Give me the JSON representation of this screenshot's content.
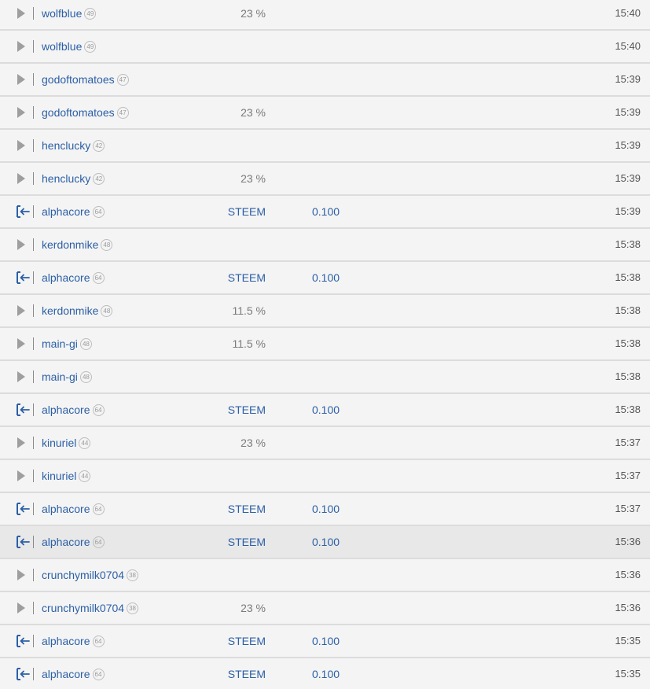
{
  "colors": {
    "link": "#2b5fa6",
    "percent_text": "#7a7a7a",
    "time_text": "#555555",
    "row_bg": "#f4f4f4",
    "row_highlight_bg": "#e8e8e8",
    "divider": "#dcdcdc",
    "play_icon": "#9e9e9e",
    "transfer_icon": "#2b5fa6"
  },
  "rows": [
    {
      "icon": "play-icon",
      "user": "wolfblue",
      "rep": "49",
      "col2": "23 %",
      "col3": "",
      "time": "15:40",
      "highlight": false
    },
    {
      "icon": "play-icon",
      "user": "wolfblue",
      "rep": "49",
      "col2": "",
      "col3": "",
      "time": "15:40",
      "highlight": false
    },
    {
      "icon": "play-icon",
      "user": "godoftomatoes",
      "rep": "47",
      "col2": "",
      "col3": "",
      "time": "15:39",
      "highlight": false
    },
    {
      "icon": "play-icon",
      "user": "godoftomatoes",
      "rep": "47",
      "col2": "23 %",
      "col3": "",
      "time": "15:39",
      "highlight": false
    },
    {
      "icon": "play-icon",
      "user": "henclucky",
      "rep": "42",
      "col2": "",
      "col3": "",
      "time": "15:39",
      "highlight": false
    },
    {
      "icon": "play-icon",
      "user": "henclucky",
      "rep": "42",
      "col2": "23 %",
      "col3": "",
      "time": "15:39",
      "highlight": false
    },
    {
      "icon": "transfer-in-icon",
      "user": "alphacore",
      "rep": "64",
      "col2": "STEEM",
      "col3": "0.100",
      "time": "15:39",
      "highlight": false
    },
    {
      "icon": "play-icon",
      "user": "kerdonmike",
      "rep": "48",
      "col2": "",
      "col3": "",
      "time": "15:38",
      "highlight": false
    },
    {
      "icon": "transfer-in-icon",
      "user": "alphacore",
      "rep": "64",
      "col2": "STEEM",
      "col3": "0.100",
      "time": "15:38",
      "highlight": false
    },
    {
      "icon": "play-icon",
      "user": "kerdonmike",
      "rep": "48",
      "col2": "11.5 %",
      "col3": "",
      "time": "15:38",
      "highlight": false
    },
    {
      "icon": "play-icon",
      "user": "main-gi",
      "rep": "48",
      "col2": "11.5 %",
      "col3": "",
      "time": "15:38",
      "highlight": false
    },
    {
      "icon": "play-icon",
      "user": "main-gi",
      "rep": "48",
      "col2": "",
      "col3": "",
      "time": "15:38",
      "highlight": false
    },
    {
      "icon": "transfer-in-icon",
      "user": "alphacore",
      "rep": "64",
      "col2": "STEEM",
      "col3": "0.100",
      "time": "15:38",
      "highlight": false
    },
    {
      "icon": "play-icon",
      "user": "kinuriel",
      "rep": "44",
      "col2": "23 %",
      "col3": "",
      "time": "15:37",
      "highlight": false
    },
    {
      "icon": "play-icon",
      "user": "kinuriel",
      "rep": "44",
      "col2": "",
      "col3": "",
      "time": "15:37",
      "highlight": false
    },
    {
      "icon": "transfer-in-icon",
      "user": "alphacore",
      "rep": "64",
      "col2": "STEEM",
      "col3": "0.100",
      "time": "15:37",
      "highlight": false
    },
    {
      "icon": "transfer-in-icon",
      "user": "alphacore",
      "rep": "64",
      "col2": "STEEM",
      "col3": "0.100",
      "time": "15:36",
      "highlight": true
    },
    {
      "icon": "play-icon",
      "user": "crunchymilk0704",
      "rep": "38",
      "col2": "",
      "col3": "",
      "time": "15:36",
      "highlight": false
    },
    {
      "icon": "play-icon",
      "user": "crunchymilk0704",
      "rep": "38",
      "col2": "23 %",
      "col3": "",
      "time": "15:36",
      "highlight": false
    },
    {
      "icon": "transfer-in-icon",
      "user": "alphacore",
      "rep": "64",
      "col2": "STEEM",
      "col3": "0.100",
      "time": "15:35",
      "highlight": false
    },
    {
      "icon": "transfer-in-icon",
      "user": "alphacore",
      "rep": "64",
      "col2": "STEEM",
      "col3": "0.100",
      "time": "15:35",
      "highlight": false
    }
  ]
}
